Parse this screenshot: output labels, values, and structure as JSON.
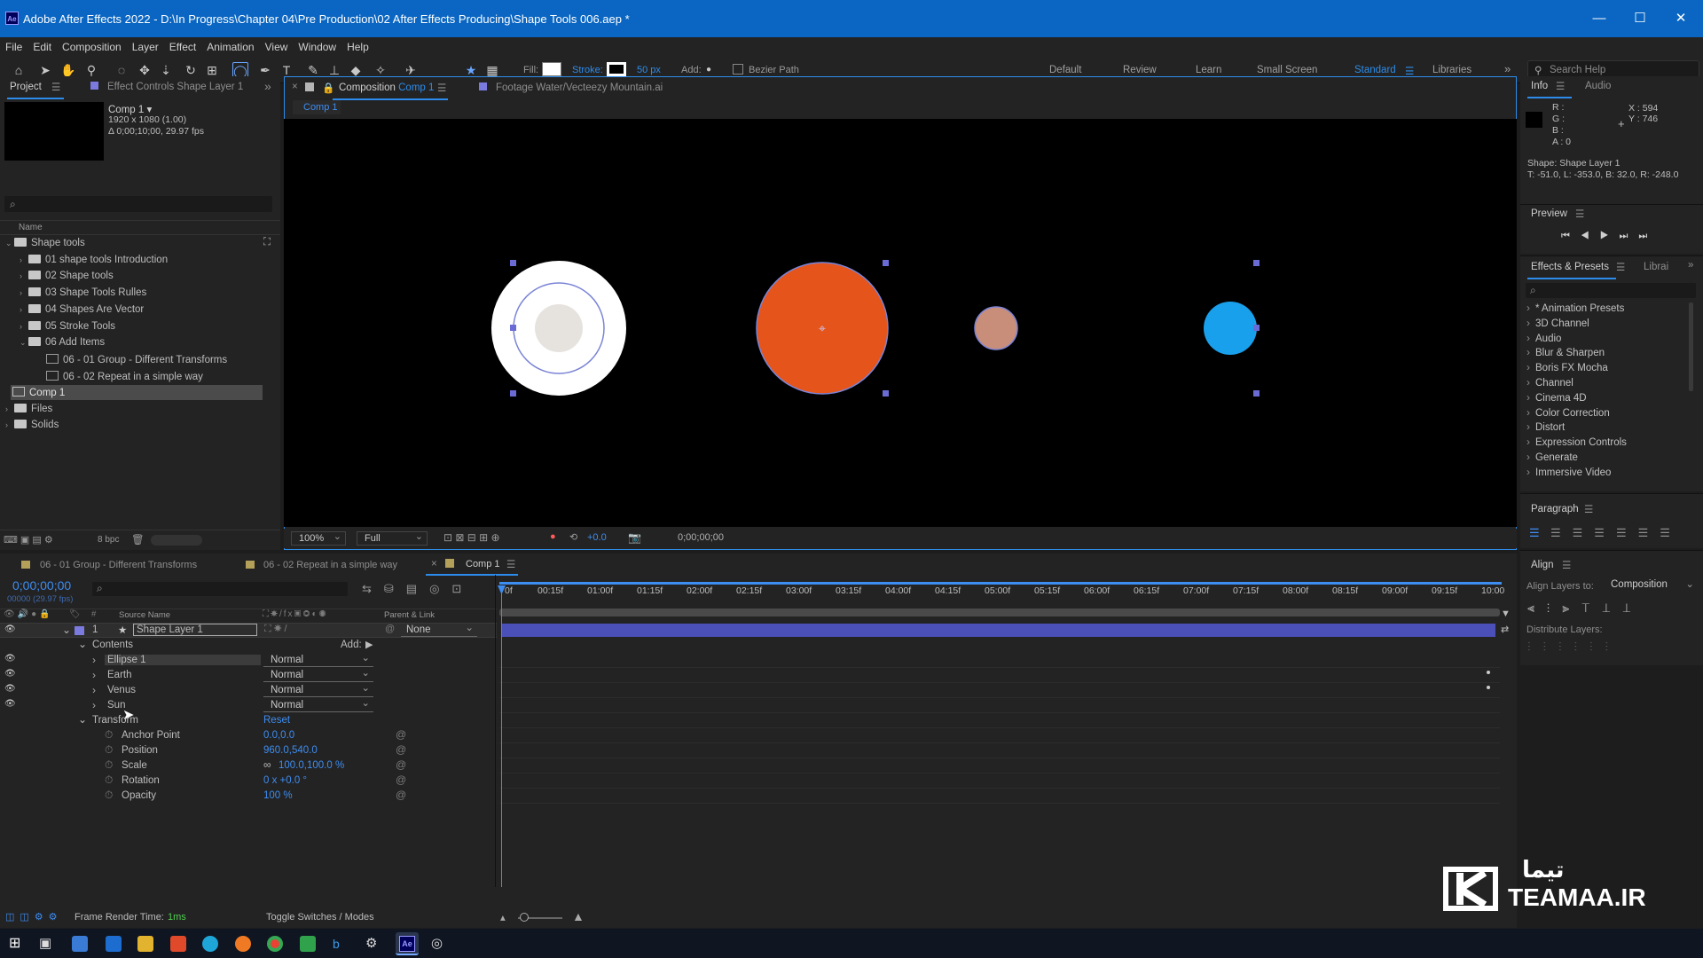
{
  "title_bar": {
    "app_icon": "Ae",
    "title": "Adobe After Effects 2022 - D:\\In Progress\\Chapter 04\\Pre Production\\02 After Effects Producing\\Shape Tools 006.aep *",
    "minimize": "—",
    "maximize": "☐",
    "close": "✕"
  },
  "menu": [
    "File",
    "Edit",
    "Composition",
    "Layer",
    "Effect",
    "Animation",
    "View",
    "Window",
    "Help"
  ],
  "toolbar": {
    "fill_label": "Fill:",
    "stroke_label": "Stroke:",
    "stroke_width": "50 px",
    "add_label": "Add:",
    "bezier_label": "Bezier Path",
    "workspaces": [
      "Default",
      "Review",
      "Learn",
      "Small Screen",
      "Standard",
      "Libraries"
    ],
    "active_workspace": "Standard",
    "search_placeholder": "Search Help"
  },
  "project_panel": {
    "tab_project": "Project",
    "tab_effect_controls": "Effect Controls Shape Layer 1",
    "comp_name": "Comp 1 ▾",
    "comp_size": "1920 x 1080 (1.00)",
    "comp_duration": "Δ 0;00;10;00, 29.97 fps",
    "search_icon": "⌕",
    "column_name": "Name",
    "items": [
      {
        "label": "Shape tools",
        "indent": 0
      },
      {
        "label": "01 shape tools Introduction",
        "indent": 1
      },
      {
        "label": "02 Shape tools",
        "indent": 1
      },
      {
        "label": "03 Shape Tools Rulles",
        "indent": 1
      },
      {
        "label": "04 Shapes Are Vector",
        "indent": 1
      },
      {
        "label": "05 Stroke Tools",
        "indent": 1
      },
      {
        "label": "06 Add Items",
        "indent": 1
      },
      {
        "label": "06 - 01 Group - Different Transforms",
        "indent": 2
      },
      {
        "label": "06 - 02 Repeat in a simple way",
        "indent": 2
      },
      {
        "label": "Comp 1",
        "indent": 0
      },
      {
        "label": "Files",
        "indent": 0
      },
      {
        "label": "Solids",
        "indent": 0
      }
    ],
    "bpc": "8 bpc"
  },
  "composition_panel": {
    "tab_label": "Composition",
    "tab_comp": "Comp 1",
    "footage_tab": "Footage  Water/Vecteezy Mountain.ai",
    "breadcrumb": "Comp 1",
    "zoom": "100%",
    "resolution": "Full",
    "exposure": "+0.0",
    "timecode": "0;00;00;00"
  },
  "info_panel": {
    "tab_info": "Info",
    "tab_audio": "Audio",
    "r": "R :",
    "g": "G :",
    "b": "B :",
    "a": "A :  0",
    "x": "X : 594",
    "y": "Y : 746",
    "shape_line1": "Shape: Shape Layer 1",
    "shape_line2": "T: -51.0, L: -353.0, B: 32.0, R: -248.0"
  },
  "preview_panel": {
    "title": "Preview"
  },
  "effects_panel": {
    "tab_effects": "Effects & Presets",
    "tab_libraries": "Librai",
    "items": [
      "* Animation Presets",
      "3D Channel",
      "Audio",
      "Blur & Sharpen",
      "Boris FX Mocha",
      "Channel",
      "Cinema 4D",
      "Color Correction",
      "Distort",
      "Expression Controls",
      "Generate",
      "Immersive Video"
    ]
  },
  "paragraph_panel": {
    "title": "Paragraph"
  },
  "align_panel": {
    "title": "Align",
    "align_to_label": "Align Layers to:",
    "align_to_value": "Composition",
    "distribute_label": "Distribute Layers:"
  },
  "timeline": {
    "tabs": [
      "06 - 01 Group - Different Transforms",
      "06 - 02 Repeat in a simple way",
      "Comp 1"
    ],
    "timecode": "0;00;00;00",
    "fps": "00000 (29.97 fps)",
    "col_source": "Source Name",
    "col_parent": "Parent & Link",
    "layer_num": "1",
    "layer_name": "Shape Layer 1",
    "parent_value": "None",
    "contents_label": "Contents",
    "add_label": "Add:",
    "groups": [
      {
        "name": "Ellipse 1",
        "mode": "Normal"
      },
      {
        "name": "Earth",
        "mode": "Normal"
      },
      {
        "name": "Venus",
        "mode": "Normal"
      },
      {
        "name": "Sun",
        "mode": "Normal"
      }
    ],
    "transform_label": "Transform",
    "reset_label": "Reset",
    "props": [
      {
        "name": "Anchor Point",
        "value": "0.0,0.0"
      },
      {
        "name": "Position",
        "value": "960.0,540.0"
      },
      {
        "name": "Scale",
        "value": "100.0,100.0 %"
      },
      {
        "name": "Rotation",
        "value": "0 x +0.0 °"
      },
      {
        "name": "Opacity",
        "value": "100 %"
      }
    ],
    "ruler": [
      "0f",
      "00:15f",
      "01:00f",
      "01:15f",
      "02:00f",
      "02:15f",
      "03:00f",
      "03:15f",
      "04:00f",
      "04:15f",
      "05:00f",
      "05:15f",
      "06:00f",
      "06:15f",
      "07:00f",
      "07:15f",
      "08:00f",
      "08:15f",
      "09:00f",
      "09:15f",
      "10:00"
    ],
    "frame_render_label": "Frame Render Time:",
    "frame_render_value": "1ms",
    "toggle_label": "Toggle Switches / Modes"
  },
  "watermark": {
    "text_fa": "تیما",
    "text_en": "TEAMAA.IR"
  },
  "colors": {
    "accent": "#2d8ceb",
    "titlebar": "#0a66c2",
    "sun": "#e5541a",
    "venus": "#c98e79",
    "earth": "#19a0ec",
    "layer_bar": "#4b4fb8"
  }
}
